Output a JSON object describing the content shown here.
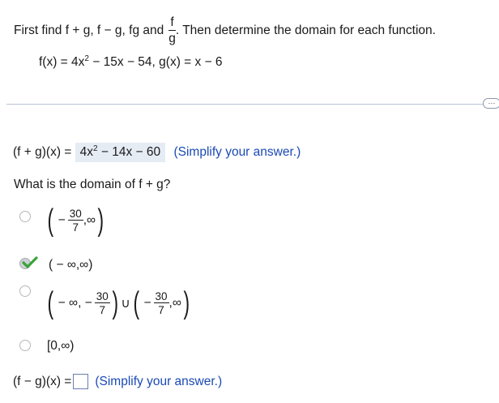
{
  "problem": {
    "intro_before": "First find f + g, f − g, fg and",
    "intro_frac_num": "f",
    "intro_frac_den": "g",
    "intro_after": ". Then determine the domain for each function.",
    "given_f_prefix": "f(x) = 4x",
    "given_f_exp": "2",
    "given_rest": " − 15x − 54, g(x) = x − 6"
  },
  "more_button": {
    "label": "···"
  },
  "part1": {
    "lhs": "(f + g)(x) = ",
    "answer_prefix": "4x",
    "answer_exp": "2",
    "answer_rest": " − 14x − 60",
    "hint": "(Simplify your answer.)"
  },
  "domain_question": "What is the domain of f + g?",
  "options": [
    {
      "minus": "−",
      "num": "30",
      "den": "7",
      "tail": ",∞"
    },
    {
      "text": "( − ∞,∞)",
      "selected": true
    },
    {
      "head": "− ∞, −",
      "num": "30",
      "den": "7",
      "union": "∪",
      "minus": "−",
      "num2": "30",
      "den2": "7",
      "tail": ",∞"
    },
    {
      "text": "[0,∞)"
    }
  ],
  "parens": {
    "left": "(",
    "right": ")"
  },
  "part2": {
    "lhs": "(f − g)(x) =",
    "hint": "(Simplify your answer.)"
  },
  "colors": {
    "hint": "#1a4ab4",
    "check": "#3aa33a",
    "rule": "#b9c3d6"
  }
}
